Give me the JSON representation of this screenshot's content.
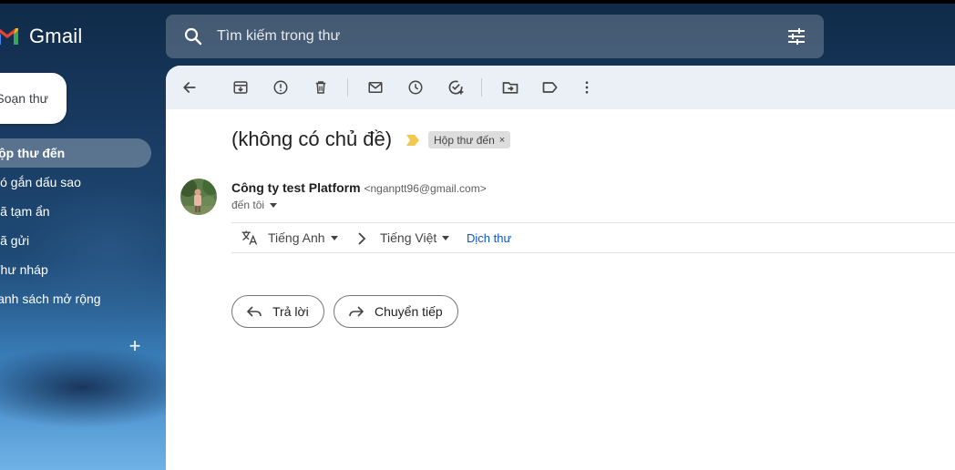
{
  "app": {
    "name": "Gmail"
  },
  "sidebar": {
    "compose_label": "Soạn thư",
    "items": [
      {
        "label": "Hộp thư đến",
        "active": true
      },
      {
        "label": "Có gắn dấu sao"
      },
      {
        "label": "Đã tạm ẩn"
      },
      {
        "label": "Đã gửi"
      },
      {
        "label": "Thư nháp"
      },
      {
        "label": "Danh sách mở rộng"
      }
    ]
  },
  "search": {
    "placeholder": "Tìm kiếm trong thư"
  },
  "toolbar": {
    "icons": [
      "back-icon",
      "archive-icon",
      "report-spam-icon",
      "delete-icon",
      "mark-unread-icon",
      "snooze-icon",
      "add-task-icon",
      "move-to-icon",
      "labels-icon",
      "more-icon"
    ]
  },
  "message": {
    "subject": "(không có chủ đề)",
    "label": "Hộp thư đến",
    "label_remove": "×",
    "sender_name": "Công ty test Platform",
    "sender_email": "<nganptt96@gmail.com>",
    "to": "đến tôi"
  },
  "translate": {
    "from": "Tiếng Anh",
    "to": "Tiếng Việt",
    "action": "Dịch thư"
  },
  "actions": {
    "reply": "Trả lời",
    "forward": "Chuyển tiếp"
  },
  "colors": {
    "label_arrow": "#f2c94c",
    "link": "#0b57d0",
    "toolbar_bg": "#eaf0f5"
  }
}
